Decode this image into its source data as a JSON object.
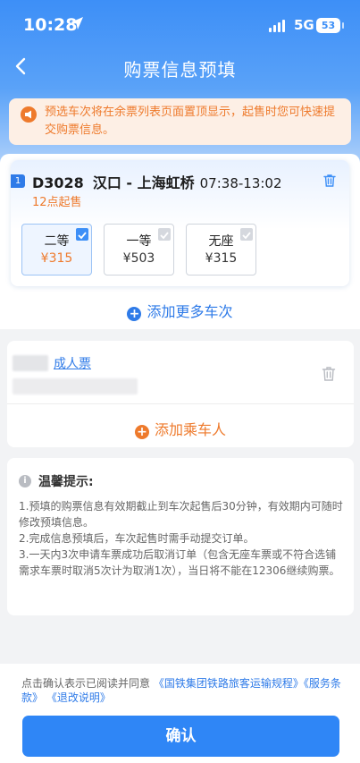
{
  "status_bar": {
    "time": "10:28",
    "network": "5G",
    "battery": "53"
  },
  "header": {
    "title": "购票信息预填"
  },
  "notice": {
    "text": "预选车次将在余票列表页面置顶显示，起售时您可快速提交购票信息。"
  },
  "train": {
    "index": "1",
    "number": "D3028",
    "from": "汉口",
    "separator": "-",
    "to": "上海虹桥",
    "time": "07:38-13:02",
    "sale_note": "12点起售",
    "seats": [
      {
        "name": "二等",
        "price": "¥315",
        "selected": true
      },
      {
        "name": "一等",
        "price": "¥503",
        "selected": false
      },
      {
        "name": "无座",
        "price": "¥315",
        "selected": false
      }
    ]
  },
  "add_train_label": "添加更多车次",
  "passenger": {
    "type": "成人票"
  },
  "add_passenger_label": "添加乘车人",
  "tips": {
    "title": "温馨提示:",
    "items": [
      "1.预填的购票信息有效期截止到车次起售后30分钟，有效期内可随时修改预填信息。",
      "2.完成信息预填后，车次起售时需手动提交订单。",
      "3.一天内3次申请车票成功后取消订单（包含无座车票或不符合选铺需求车票时取消5次计为取消1次），当日将不能在12306继续购票。"
    ]
  },
  "agreement": {
    "prefix": "点击确认表示已阅读并同意",
    "link1": "《国铁集团铁路旅客运输规程》",
    "link2": "《服务条款》",
    "link3": "《退改说明》"
  },
  "confirm_label": "确认",
  "colors": {
    "primary": "#2f86f6",
    "accent": "#ee7a2c",
    "notice_bg": "#fdefe5"
  }
}
